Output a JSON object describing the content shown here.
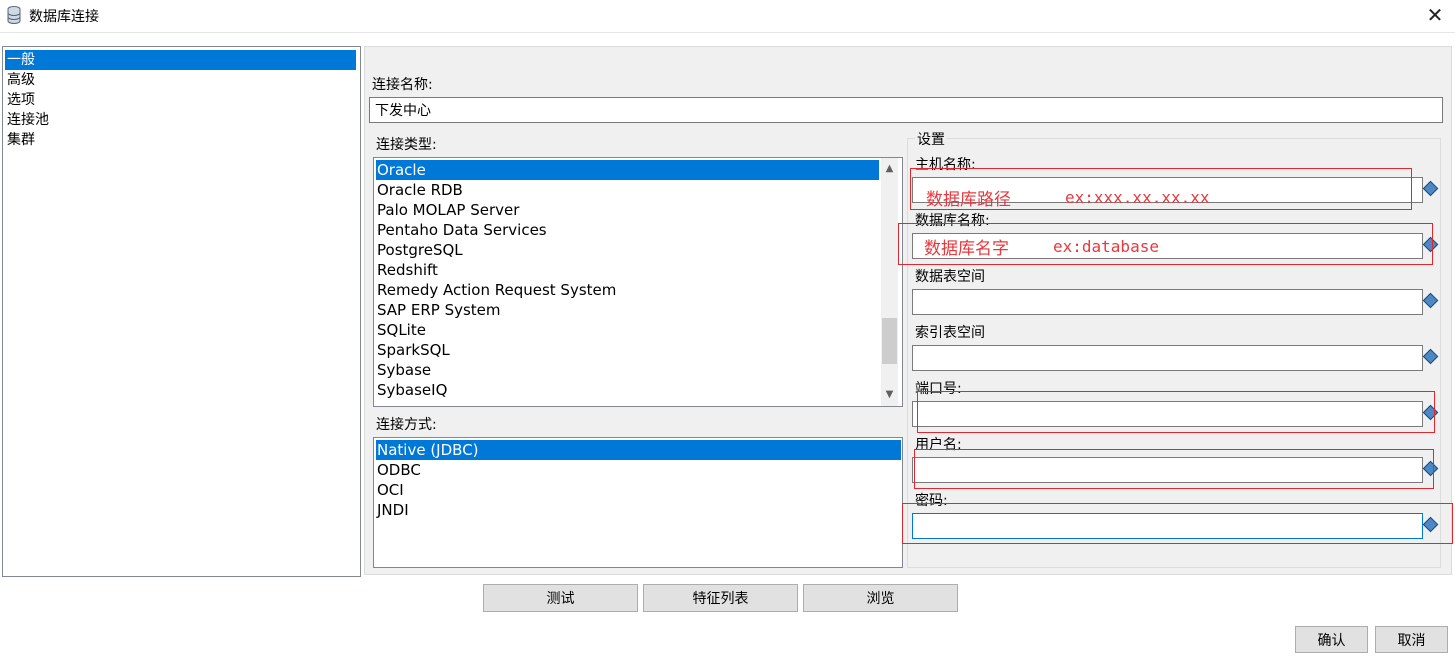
{
  "window": {
    "title": "数据库连接",
    "close_glyph": "✕"
  },
  "nav": {
    "items": [
      "一般",
      "高级",
      "选项",
      "连接池",
      "集群"
    ],
    "selected": 0
  },
  "connection_name": {
    "label": "连接名称:",
    "value": "下发中心"
  },
  "connection_type": {
    "label": "连接类型:",
    "items": [
      "Oracle",
      "Oracle RDB",
      "Palo MOLAP Server",
      "Pentaho Data Services",
      "PostgreSQL",
      "Redshift",
      "Remedy Action Request System",
      "SAP ERP System",
      "SQLite",
      "SparkSQL",
      "Sybase",
      "SybaseIQ"
    ],
    "selected": 0
  },
  "access_method": {
    "label": "连接方式:",
    "items": [
      "Native (JDBC)",
      "ODBC",
      "OCI",
      "JNDI"
    ],
    "selected": 0
  },
  "settings": {
    "title": "设置",
    "fields": {
      "host": {
        "label": "主机名称:",
        "value": ""
      },
      "database": {
        "label": "数据库名称:",
        "value": ""
      },
      "tablespace": {
        "label": "数据表空间",
        "value": ""
      },
      "index_tablespace": {
        "label": "索引表空间",
        "value": ""
      },
      "port": {
        "label": "端口号:",
        "value": ""
      },
      "username": {
        "label": "用户名:",
        "value": ""
      },
      "password": {
        "label": "密码:",
        "value": ""
      }
    },
    "annotations": {
      "host_hint": "数据库路径",
      "host_example": "ex:xxx.xx.xx.xx",
      "database_hint": "数据库名字",
      "database_example": "ex:database"
    },
    "variable_icon": "variable-diamond-icon"
  },
  "buttons": {
    "test": "测试",
    "features": "特征列表",
    "explore": "浏览",
    "ok": "确认",
    "cancel": "取消"
  },
  "colors": {
    "selection": "#0078d7",
    "annotation_red": "#e0282e",
    "panel_bg": "#f0f0f0"
  }
}
